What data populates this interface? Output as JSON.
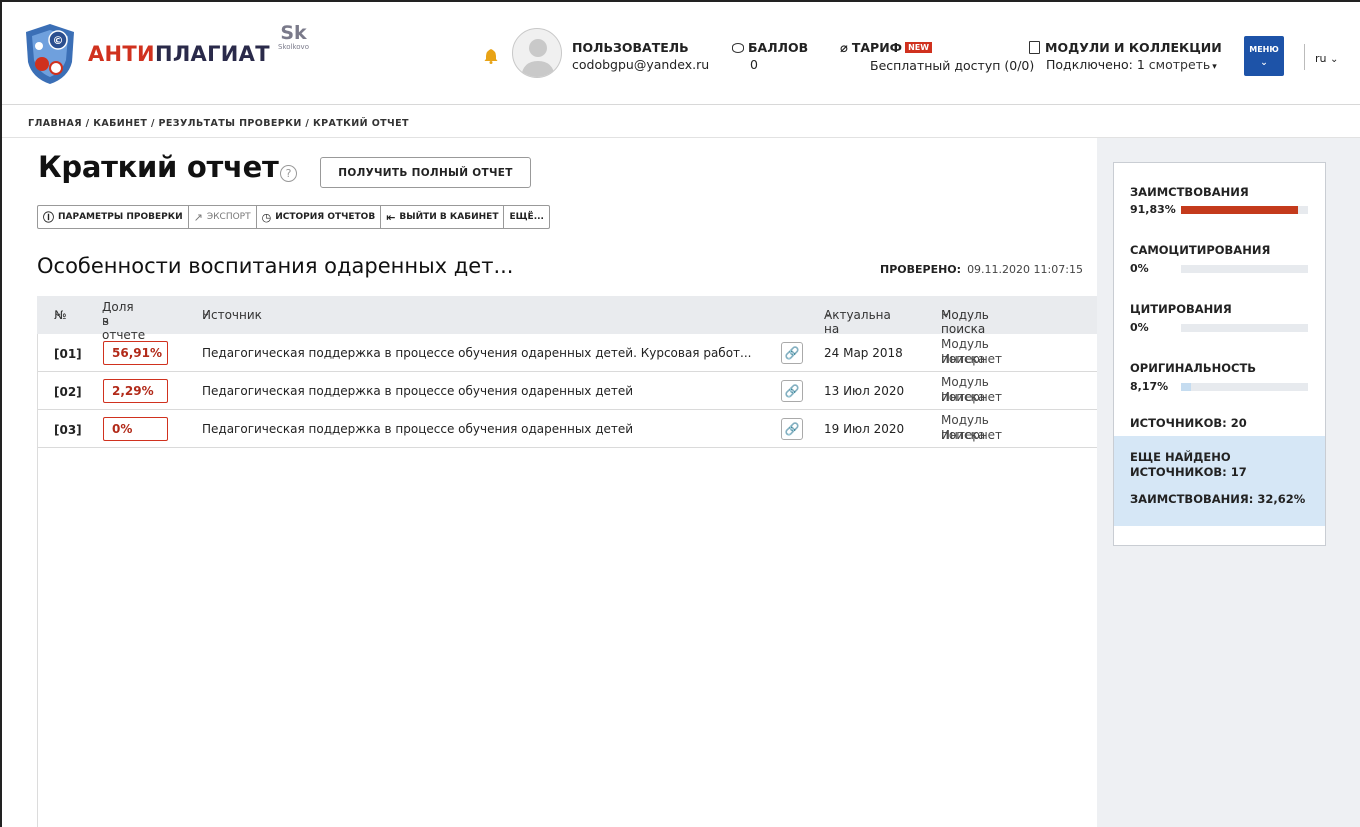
{
  "header": {
    "brand_a": "АНТИ",
    "brand_b": "ПЛАГИАТ",
    "skolkovo_mark": "Sk",
    "skolkovo_sub": "Skolkovo",
    "user_title": "ПОЛЬЗОВАТЕЛЬ",
    "user_email": "codobgpu@yandex.ru",
    "balls_title": "БАЛЛОВ",
    "balls_value": "0",
    "tarif_title": "ТАРИФ",
    "tarif_badge": "NEW",
    "tarif_value": "Бесплатный доступ (0/0)",
    "modules_title": "МОДУЛИ И КОЛЛЕКЦИИ",
    "modules_value": "Подключено: 1",
    "modules_link": "смотреть",
    "menu_label": "МЕНЮ",
    "lang": "ru"
  },
  "breadcrumb": "ГЛАВНАЯ / КАБИНЕТ / РЕЗУЛЬТАТЫ ПРОВЕРКИ / КРАТКИЙ ОТЧЕТ",
  "page": {
    "title": "Краткий отчет",
    "full_report_btn": "ПОЛУЧИТЬ ПОЛНЫЙ ОТЧЕТ",
    "toolbar": {
      "params": "ПАРАМЕТРЫ ПРОВЕРКИ",
      "export": "ЭКСПОРТ",
      "history": "ИСТОРИЯ ОТЧЕТОВ",
      "exit": "ВЫЙТИ В КАБИНЕТ",
      "more": "ЕЩЁ..."
    },
    "doc_title": "Особенности воспитания одаренных дет...",
    "checked_label": "ПРОВЕРЕНО:",
    "checked_date": "09.11.2020 11:07:15"
  },
  "table": {
    "headers": {
      "num": "№",
      "share_1": "Доля",
      "share_2": "в отчете",
      "source": "Источник",
      "date": "Актуальна на",
      "module": "Модуль поиска"
    },
    "rows": [
      {
        "num": "[01]",
        "share": "56,91%",
        "source": "Педагогическая поддержка в процессе обучения одаренных детей. Курсовая работ...",
        "date": "24 Мар 2018",
        "module_1": "Модуль поиска",
        "module_2": "Интернет"
      },
      {
        "num": "[02]",
        "share": "2,29%",
        "source": "Педагогическая поддержка в процессе обучения одаренных детей",
        "date": "13 Июл 2020",
        "module_1": "Модуль поиска",
        "module_2": "Интернет"
      },
      {
        "num": "[03]",
        "share": "0%",
        "source": "Педагогическая поддержка в процессе обучения одаренных детей",
        "date": "19 Июл 2020",
        "module_1": "Модуль поиска",
        "module_2": "Интернет"
      }
    ]
  },
  "stats": {
    "borrow_label": "ЗАИМСТВОВАНИЯ",
    "borrow_value": "91,83%",
    "borrow_pct": 91.83,
    "selfcite_label": "САМОЦИТИРОВАНИЯ",
    "selfcite_value": "0%",
    "selfcite_pct": 0,
    "cite_label": "ЦИТИРОВАНИЯ",
    "cite_value": "0%",
    "cite_pct": 0,
    "orig_label": "ОРИГИНАЛЬНОСТЬ",
    "orig_value": "8,17%",
    "orig_pct": 8.17,
    "sources": "ИСТОЧНИКОВ: 20",
    "found_1": "ЕЩЕ НАЙДЕНО",
    "found_2": "ИСТОЧНИКОВ: 17",
    "found_3": "ЗАИМСТВОВАНИЯ: 32,62%",
    "borrow_color": "#c43a1c",
    "orig_color": "#c5dcf0"
  }
}
